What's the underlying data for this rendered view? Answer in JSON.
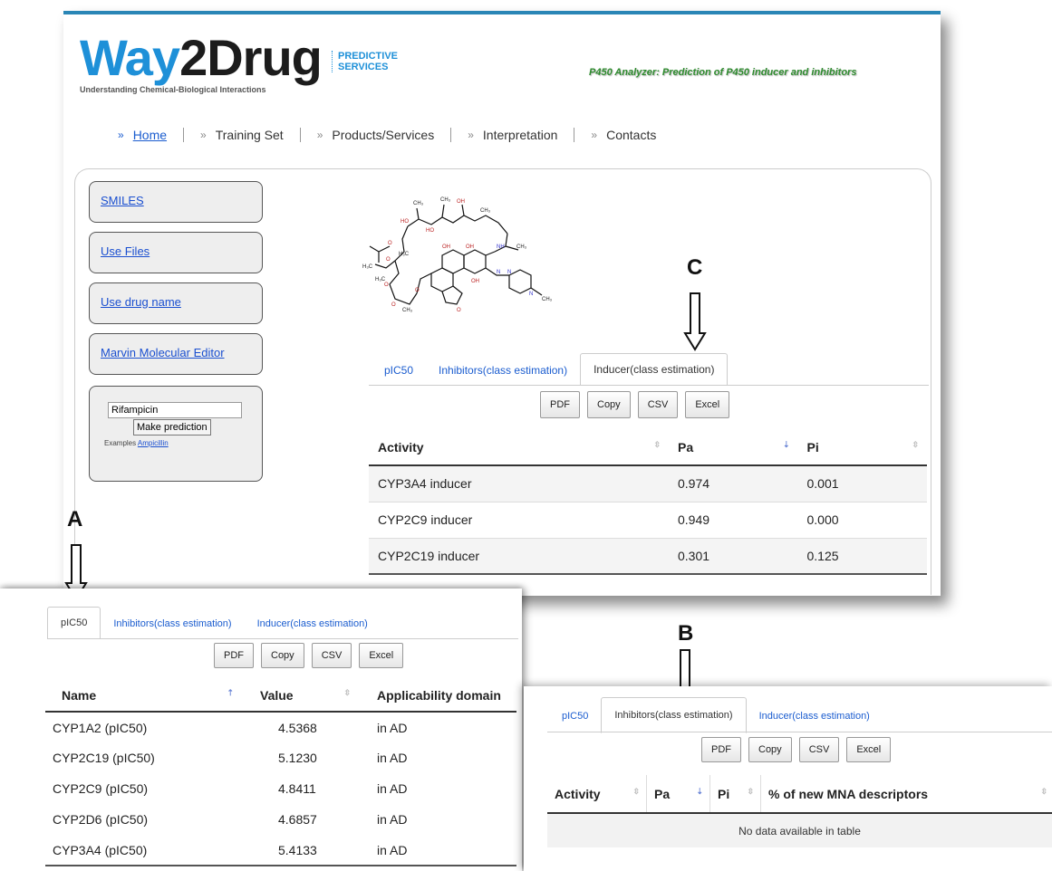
{
  "header": {
    "logo_way": "Way",
    "logo_2drug": "2Drug",
    "logo_sub": "Understanding Chemical-Biological Interactions",
    "logo_predictive": "PREDICTIVE",
    "logo_services": "SERVICES",
    "tagline": "P450 Analyzer: Prediction of P450 inducer and inhibitors"
  },
  "nav": {
    "items": [
      {
        "label": "Home"
      },
      {
        "label": "Training Set"
      },
      {
        "label": "Products/Services"
      },
      {
        "label": "Interpretation"
      },
      {
        "label": "Contacts"
      }
    ],
    "separator": "»"
  },
  "sidebar": {
    "items": [
      {
        "label": "SMILES"
      },
      {
        "label": "Use Files"
      },
      {
        "label": "Use drug name"
      },
      {
        "label": "Marvin Molecular Editor"
      }
    ],
    "drug_input_value": "Rifampicin",
    "make_prediction": "Make prediction",
    "examples_label": "Examples",
    "examples_link": "Ampicillin"
  },
  "molecule_labels": [
    "CH3",
    "CH3",
    "HO",
    "HO",
    "OH",
    "CH3",
    "O",
    "H3C",
    "H3C",
    "O",
    "CH3",
    "OH",
    "OH",
    "NH",
    "CH3",
    "H3C",
    "O",
    "OH",
    "N",
    "N",
    "N",
    "CH3",
    "O",
    "O",
    "CH3",
    "O"
  ],
  "tabs": [
    "pIC50",
    "Inhibitors(class estimation)",
    "Inducer(class estimation)"
  ],
  "buttons": [
    "PDF",
    "Copy",
    "CSV",
    "Excel"
  ],
  "panel_c": {
    "columns": [
      "Activity",
      "Pa",
      "Pi"
    ],
    "rows": [
      [
        "CYP3A4 inducer",
        "0.974",
        "0.001"
      ],
      [
        "CYP2C9 inducer",
        "0.949",
        "0.000"
      ],
      [
        "CYP2C19 inducer",
        "0.301",
        "0.125"
      ]
    ]
  },
  "panel_a": {
    "columns": [
      "Name",
      "Value",
      "Applicability domain"
    ],
    "rows": [
      [
        "CYP1A2 (pIC50)",
        "4.5368",
        "in AD"
      ],
      [
        "CYP2C19 (pIC50)",
        "5.1230",
        "in AD"
      ],
      [
        "CYP2C9 (pIC50)",
        "4.8411",
        "in AD"
      ],
      [
        "CYP2D6 (pIC50)",
        "4.6857",
        "in AD"
      ],
      [
        "CYP3A4 (pIC50)",
        "5.4133",
        "in AD"
      ]
    ]
  },
  "panel_b": {
    "columns": [
      "Activity",
      "Pa",
      "Pi",
      "% of new MNA descriptors"
    ],
    "empty_message": "No data available in table"
  },
  "annotations": {
    "a": "A",
    "b": "B",
    "c": "C"
  }
}
